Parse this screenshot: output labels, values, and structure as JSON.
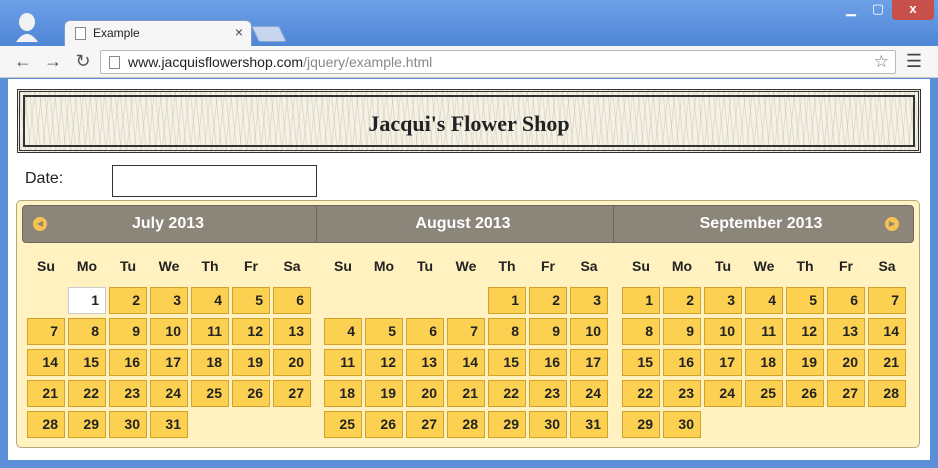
{
  "browser": {
    "tab_title": "Example",
    "tab_close": "×",
    "url_host": "www.jacquisflowershop.com",
    "url_path": "/jquery/example.html",
    "window_min": "▁",
    "window_max": "▢",
    "window_close": "x"
  },
  "page": {
    "heading": "Jacqui's Flower Shop",
    "date_label": "Date:",
    "date_value": ""
  },
  "datepicker": {
    "weekdays": [
      "Su",
      "Mo",
      "Tu",
      "We",
      "Th",
      "Fr",
      "Sa"
    ],
    "months": [
      {
        "title": "July 2013",
        "first_weekday": 1,
        "days": 31,
        "highlight_day": 1
      },
      {
        "title": "August 2013",
        "first_weekday": 4,
        "days": 31
      },
      {
        "title": "September 2013",
        "first_weekday": 0,
        "days": 30
      }
    ]
  }
}
